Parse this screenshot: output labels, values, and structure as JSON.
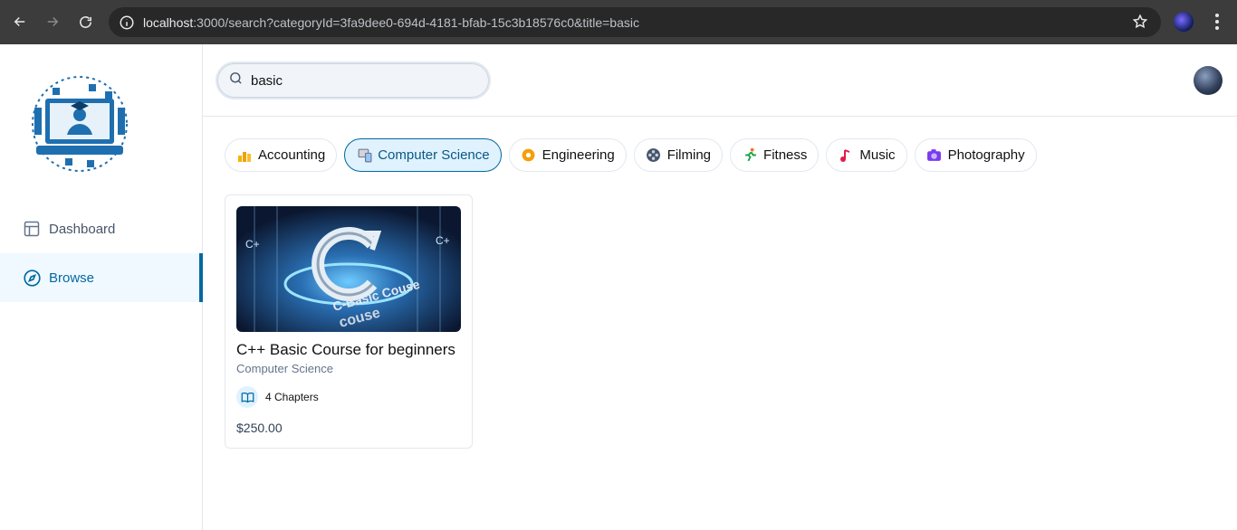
{
  "browser": {
    "url_host": "localhost",
    "url_rest": ":3000/search?categoryId=3fa9dee0-694d-4181-bfab-15c3b18576c0&title=basic"
  },
  "sidebar": {
    "items": [
      {
        "label": "Dashboard",
        "icon": "layout-icon"
      },
      {
        "label": "Browse",
        "icon": "compass-icon",
        "active": true
      }
    ]
  },
  "search": {
    "value": "basic"
  },
  "categories": [
    {
      "label": "Accounting",
      "icon": "📊"
    },
    {
      "label": "Computer Science",
      "icon": "💻",
      "active": true
    },
    {
      "label": "Engineering",
      "icon": "⚙️"
    },
    {
      "label": "Filming",
      "icon": "🎞️"
    },
    {
      "label": "Fitness",
      "icon": "🏃"
    },
    {
      "label": "Music",
      "icon": "🎵"
    },
    {
      "label": "Photography",
      "icon": "📷"
    }
  ],
  "course": {
    "title": "C++ Basic Course for beginners",
    "category": "Computer Science",
    "chapters": "4 Chapters",
    "price": "$250.00"
  },
  "colors": {
    "accent": "#0369a1",
    "active_bg": "#e0f2fe"
  }
}
